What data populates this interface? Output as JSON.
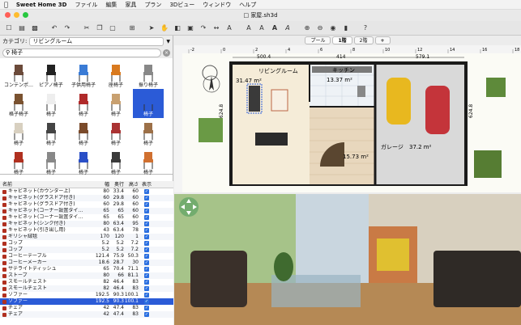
{
  "menubar": {
    "app": "Sweet Home 3D",
    "items": [
      "ファイル",
      "編集",
      "家具",
      "プラン",
      "3Dビュー",
      "ウィンドウ",
      "ヘルプ"
    ]
  },
  "window": {
    "title": "家屋.sh3d"
  },
  "catalog": {
    "category_label": "カテゴリ:",
    "category_value": "リビングルーム",
    "search_value": "椅子",
    "items": [
      {
        "label": "コンテンポ…"
      },
      {
        "label": "ピアノ椅子"
      },
      {
        "label": "子供用椅子"
      },
      {
        "label": "座椅子"
      },
      {
        "label": "振り椅子"
      },
      {
        "label": "格子椅子"
      },
      {
        "label": "椅子"
      },
      {
        "label": "椅子"
      },
      {
        "label": "椅子"
      },
      {
        "label": "椅子"
      },
      {
        "label": "椅子"
      },
      {
        "label": "椅子"
      },
      {
        "label": "椅子"
      },
      {
        "label": "椅子"
      },
      {
        "label": "椅子"
      },
      {
        "label": "椅子"
      },
      {
        "label": "椅子"
      },
      {
        "label": "椅子"
      },
      {
        "label": "椅子"
      },
      {
        "label": "椅子"
      }
    ]
  },
  "furniture_table": {
    "headers": {
      "name": "名前",
      "width": "幅",
      "depth": "奥行",
      "height": "高さ",
      "visible": "表示"
    },
    "rows": [
      {
        "name": "キャビネット(カウンター上)",
        "w": "80",
        "d": "33.4",
        "h": "60"
      },
      {
        "name": "キャビネット(グラスドア付き)",
        "w": "60",
        "d": "29.8",
        "h": "60"
      },
      {
        "name": "キャビネット(グラスドア付き)",
        "w": "60",
        "d": "29.8",
        "h": "60"
      },
      {
        "name": "キャビネット(コーナー設置タイ…",
        "w": "65",
        "d": "65",
        "h": "60"
      },
      {
        "name": "キャビネット(コーナー設置タイ…",
        "w": "65",
        "d": "65",
        "h": "60"
      },
      {
        "name": "キャビネット(シンク付き)",
        "w": "80",
        "d": "63.4",
        "h": "95"
      },
      {
        "name": "キャビネット(引き出し用)",
        "w": "43",
        "d": "63.4",
        "h": "78"
      },
      {
        "name": "ギリシャ絨毯",
        "w": "170",
        "d": "120",
        "h": "1"
      },
      {
        "name": "コップ",
        "w": "5.2",
        "d": "5.2",
        "h": "7.2"
      },
      {
        "name": "コップ",
        "w": "5.2",
        "d": "5.2",
        "h": "7.2"
      },
      {
        "name": "コーヒーテーブル",
        "w": "121.4",
        "d": "75.9",
        "h": "50.3"
      },
      {
        "name": "コーヒーメーカー",
        "w": "18.6",
        "d": "28.7",
        "h": "30"
      },
      {
        "name": "サテライトディッシュ",
        "w": "65",
        "d": "70.4",
        "h": "71.1"
      },
      {
        "name": "ストーブ",
        "w": "80",
        "d": "66",
        "h": "81.1"
      },
      {
        "name": "スモールチェスト",
        "w": "82",
        "d": "46.4",
        "h": "83"
      },
      {
        "name": "スモールチェスト",
        "w": "82",
        "d": "46.4",
        "h": "83"
      },
      {
        "name": "ソファー",
        "w": "192.5",
        "d": "90.3",
        "h": "100.1"
      },
      {
        "name": "ソファー",
        "w": "192.5",
        "d": "90.3",
        "h": "100.1"
      },
      {
        "name": "チェア",
        "w": "42",
        "d": "47.4",
        "h": "83"
      },
      {
        "name": "チェア",
        "w": "42",
        "d": "47.4",
        "h": "83"
      }
    ]
  },
  "levels": {
    "tabs": [
      "プール",
      "1階",
      "2階"
    ],
    "add": "+"
  },
  "plan": {
    "rooms": [
      {
        "name": "リビングルーム",
        "area": "31.47 m²"
      },
      {
        "name": "キッチン",
        "area": "13.37 m²"
      },
      {
        "name": "",
        "area": "15.73 m²"
      },
      {
        "name": "ガレージ",
        "area": "37.2 m²"
      }
    ],
    "dimensions": [
      "500.4",
      "414",
      "579.1",
      "624.8",
      "624.8"
    ],
    "ruler_top": [
      "-2",
      "0",
      "2",
      "4",
      "6",
      "8",
      "10",
      "12",
      "14",
      "16",
      "18"
    ]
  },
  "colors": {
    "selection": "#2b5bd7",
    "wall": "#1a1a1a",
    "checkbox": "#2b6fe0"
  }
}
